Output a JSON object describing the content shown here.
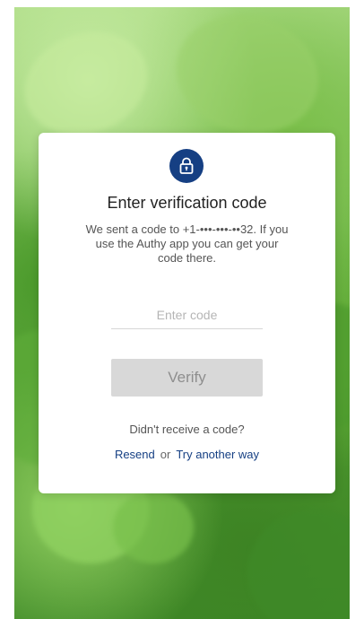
{
  "dialog": {
    "icon": "lock-icon",
    "title": "Enter verification code",
    "message": "We sent a code to +1-•••-•••-••32. If you use the Authy app you can get your code there.",
    "code_input": {
      "value": "",
      "placeholder": "Enter code"
    },
    "verify_label": "Verify",
    "no_code_text": "Didn't receive a code?",
    "resend_label": "Resend",
    "or_text": "or",
    "try_another_label": "Try another way"
  },
  "colors": {
    "accent": "#153f83",
    "button_disabled_bg": "#d8d8d8",
    "background_green": "#6fb548"
  }
}
